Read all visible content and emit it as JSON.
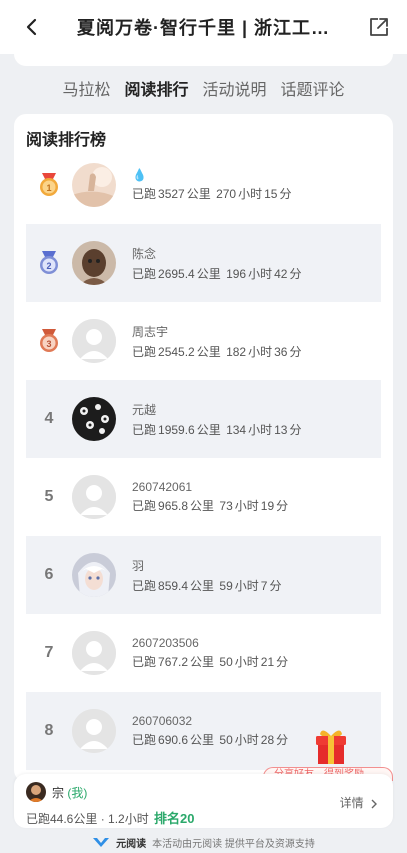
{
  "header": {
    "title": "夏阅万卷·智行千里 | 浙江工…"
  },
  "tabs": [
    {
      "label": "马拉松"
    },
    {
      "label": "阅读排行"
    },
    {
      "label": "活动说明"
    },
    {
      "label": "话题评论"
    }
  ],
  "ranking": {
    "title": "阅读排行榜",
    "unit_km": "公里",
    "unit_hour": "小时",
    "unit_min": "分",
    "prefix": "已跑",
    "rows": [
      {
        "rank": "1",
        "name": "💧",
        "km": "3527",
        "hours": "270",
        "minutes": "15"
      },
      {
        "rank": "2",
        "name": "陈念",
        "km": "2695.4",
        "hours": "196",
        "minutes": "42"
      },
      {
        "rank": "3",
        "name": "周志宇",
        "km": "2545.2",
        "hours": "182",
        "minutes": "36"
      },
      {
        "rank": "4",
        "name": "元越",
        "km": "1959.6",
        "hours": "134",
        "minutes": "13"
      },
      {
        "rank": "5",
        "name": "260742061",
        "km": "965.8",
        "hours": "73",
        "minutes": "19"
      },
      {
        "rank": "6",
        "name": "羽",
        "km": "859.4",
        "hours": "59",
        "minutes": "7"
      },
      {
        "rank": "7",
        "name": "2607203506",
        "km": "767.2",
        "hours": "50",
        "minutes": "21"
      },
      {
        "rank": "8",
        "name": "260706032",
        "km": "690.6",
        "hours": "50",
        "minutes": "28"
      }
    ]
  },
  "me": {
    "name": "宗",
    "tag": "(我)",
    "stats": "已跑44.6公里 · 1.2小时",
    "rank_label": "排名20",
    "detail": "详情"
  },
  "promo": {
    "strip_text": "分享好友，得到奖励"
  },
  "footer": {
    "brand": "元阅读",
    "text": "本活动由元阅读 提供平台及资源支持"
  },
  "colors": {
    "accent_green": "#2aa86a",
    "row_shade": "#f0f2f6",
    "medal_gold": "#f2a93b",
    "medal_silver": "#7f8fd6",
    "medal_bronze": "#e07a56"
  }
}
